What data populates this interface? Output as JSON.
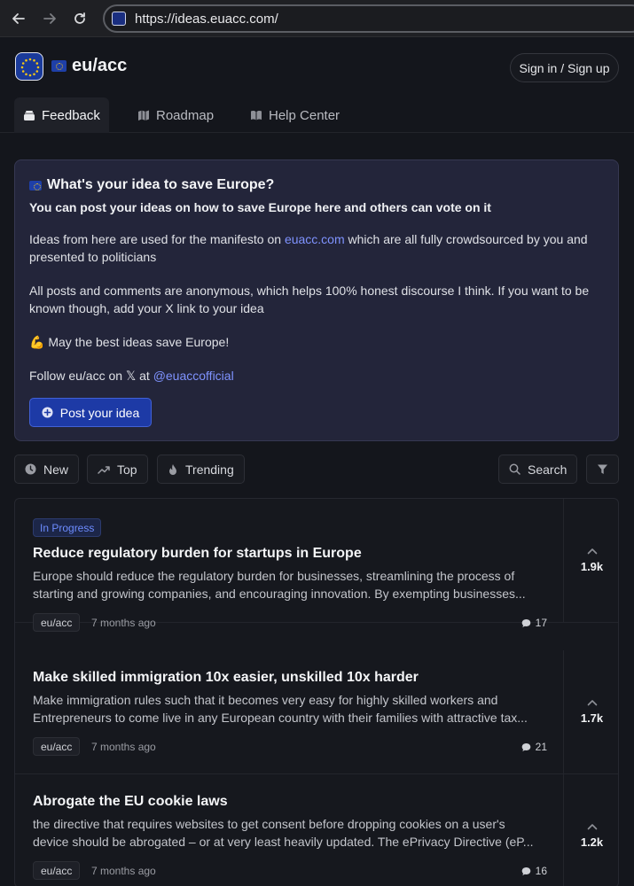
{
  "browser": {
    "url": "https://ideas.euacc.com/"
  },
  "header": {
    "brand": "eu/acc",
    "signin_label": "Sign in / Sign up"
  },
  "tabs": [
    {
      "label": "Feedback",
      "icon": "inbox-icon",
      "active": true
    },
    {
      "label": "Roadmap",
      "icon": "map-icon",
      "active": false
    },
    {
      "label": "Help Center",
      "icon": "book-icon",
      "active": false
    }
  ],
  "info": {
    "title": "What's your idea to save Europe?",
    "subtitle": "You can post your ideas on how to save Europe here and others can vote on it",
    "p1_before": "Ideas from here are used for the manifesto on ",
    "p1_link": "euacc.com",
    "p1_after": " which are all fully crowdsourced by you and presented to politicians",
    "p2": "All posts and comments are anonymous, which helps 100% honest discourse I think. If you want to be known though, add your X link to your idea",
    "p3": "💪 May the best ideas save Europe!",
    "p4_before": "Follow eu/acc on 𝕏 at ",
    "p4_link": "@euaccofficial",
    "post_button": "Post your idea"
  },
  "filters": {
    "new": "New",
    "top": "Top",
    "trending": "Trending",
    "search": "Search"
  },
  "posts": [
    {
      "badge": "In Progress",
      "title": "Reduce regulatory burden for startups in Europe",
      "desc_line1": "Europe should reduce the regulatory burden for businesses, streamlining the process of",
      "desc_line2": "starting and growing companies, and encouraging innovation. By exempting businesses...",
      "tag": "eu/acc",
      "time": "7 months ago",
      "comments": "17",
      "votes": "1.9k"
    },
    {
      "badge": "",
      "title": "Make skilled immigration 10x easier, unskilled 10x harder",
      "desc_line1": "Make immigration rules such that it becomes very easy for highly skilled workers and",
      "desc_line2": "Entrepreneurs to come live in any European country with their families with attractive tax...",
      "tag": "eu/acc",
      "time": "7 months ago",
      "comments": "21",
      "votes": "1.7k"
    },
    {
      "badge": "",
      "title": "Abrogate the EU cookie laws",
      "desc_line1": "the directive that requires websites to get consent before dropping cookies on a user's",
      "desc_line2": "device should be abrogated – or at very least heavily updated. The ePrivacy Directive (eP...",
      "tag": "eu/acc",
      "time": "7 months ago",
      "comments": "16",
      "votes": "1.2k"
    }
  ]
}
